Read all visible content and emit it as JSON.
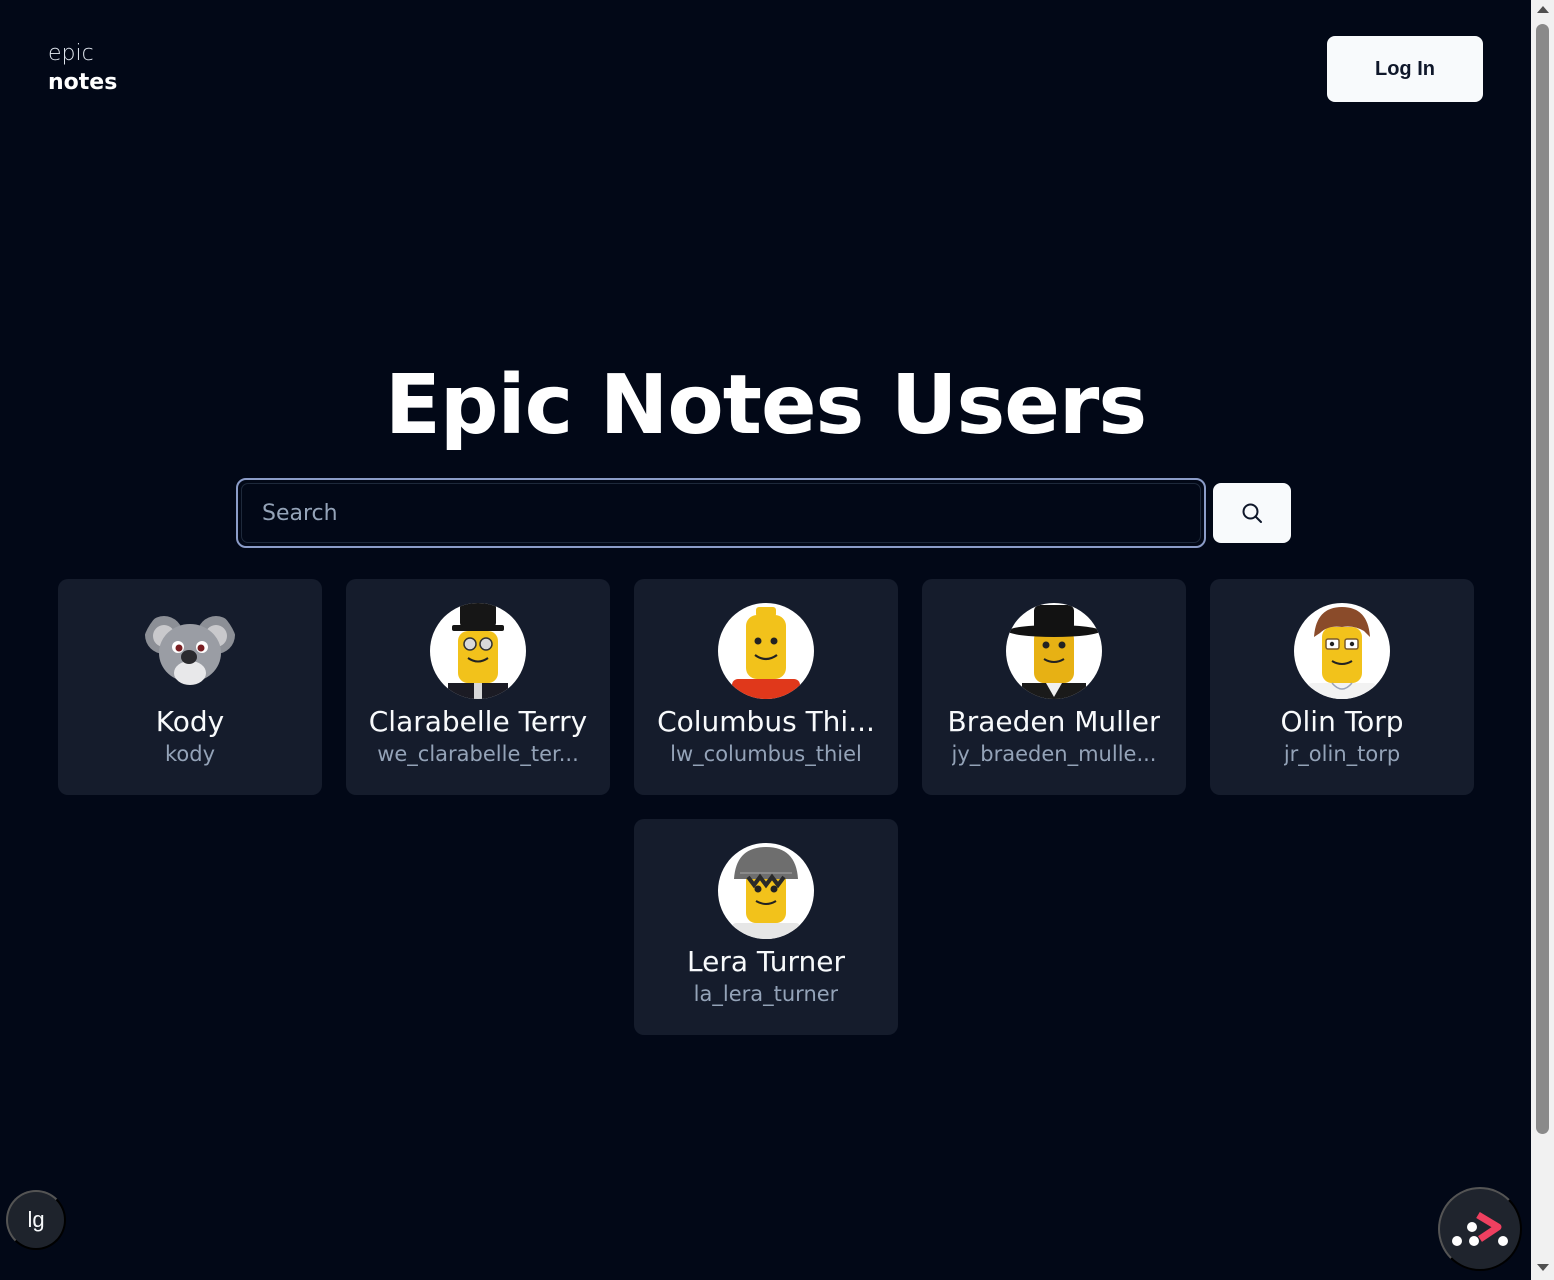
{
  "header": {
    "logo_line1": "epic",
    "logo_line2": "notes",
    "login_label": "Log In"
  },
  "main": {
    "title": "Epic Notes Users",
    "search_placeholder": "Search"
  },
  "users": [
    {
      "name": "Kody",
      "username": "kody",
      "avatar": "koala-avatar"
    },
    {
      "name": "Clarabelle Terry",
      "username": "we_clarabelle_ter...",
      "avatar": "lego-top-hat-glasses-avatar"
    },
    {
      "name": "Columbus Thi...",
      "username": "lw_columbus_thiel",
      "avatar": "lego-plain-red-shirt-avatar"
    },
    {
      "name": "Braeden Muller",
      "username": "jy_braeden_mulle...",
      "avatar": "lego-black-hat-avatar"
    },
    {
      "name": "Olin Torp",
      "username": "jr_olin_torp",
      "avatar": "lego-brown-hair-glasses-avatar"
    },
    {
      "name": "Lera Turner",
      "username": "la_lera_turner",
      "avatar": "lego-grey-cap-avatar"
    }
  ],
  "footer": {
    "theme_label": "lg"
  },
  "colors": {
    "background": "#020817",
    "card": "#151c2c",
    "muted_text": "#94a3b8",
    "accent_red": "#ef4060"
  }
}
